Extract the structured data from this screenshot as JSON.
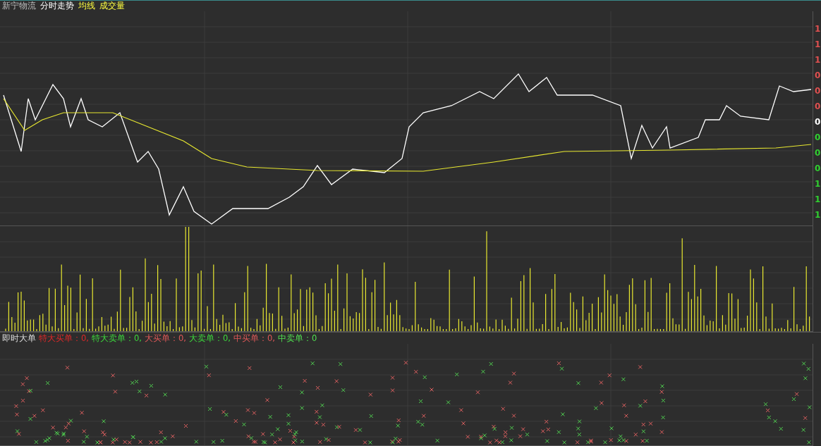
{
  "header": {
    "items": [
      {
        "text": "新宁物流",
        "kind": "name"
      },
      {
        "text": "分时走势",
        "kind": "mode"
      },
      {
        "text": "均线",
        "kind": "indicator"
      },
      {
        "text": "成交量",
        "kind": "indicator"
      }
    ]
  },
  "price_axis": {
    "labels": [
      {
        "text": "1",
        "kind": "up"
      },
      {
        "text": "1",
        "kind": "up"
      },
      {
        "text": "1",
        "kind": "up"
      },
      {
        "text": "0",
        "kind": "up"
      },
      {
        "text": "0",
        "kind": "up"
      },
      {
        "text": "0",
        "kind": "up"
      },
      {
        "text": "0",
        "kind": "flat"
      },
      {
        "text": "0",
        "kind": "down"
      },
      {
        "text": "0",
        "kind": "down"
      },
      {
        "text": "0",
        "kind": "down"
      },
      {
        "text": "1",
        "kind": "down"
      },
      {
        "text": "1",
        "kind": "down"
      },
      {
        "text": "1",
        "kind": "down"
      }
    ]
  },
  "order_panel": {
    "title": "即时大单",
    "items": [
      {
        "text": "特大买单：0,",
        "color": "#e02828"
      },
      {
        "text": "特大卖单：0,",
        "color": "#3cd83c"
      },
      {
        "text": "大买单：0,",
        "color": "#e05858"
      },
      {
        "text": "大卖单：0,",
        "color": "#3cd83c"
      },
      {
        "text": "中买单：0,",
        "color": "#e05858"
      },
      {
        "text": "中卖单：0",
        "color": "#50e050"
      }
    ]
  }
}
